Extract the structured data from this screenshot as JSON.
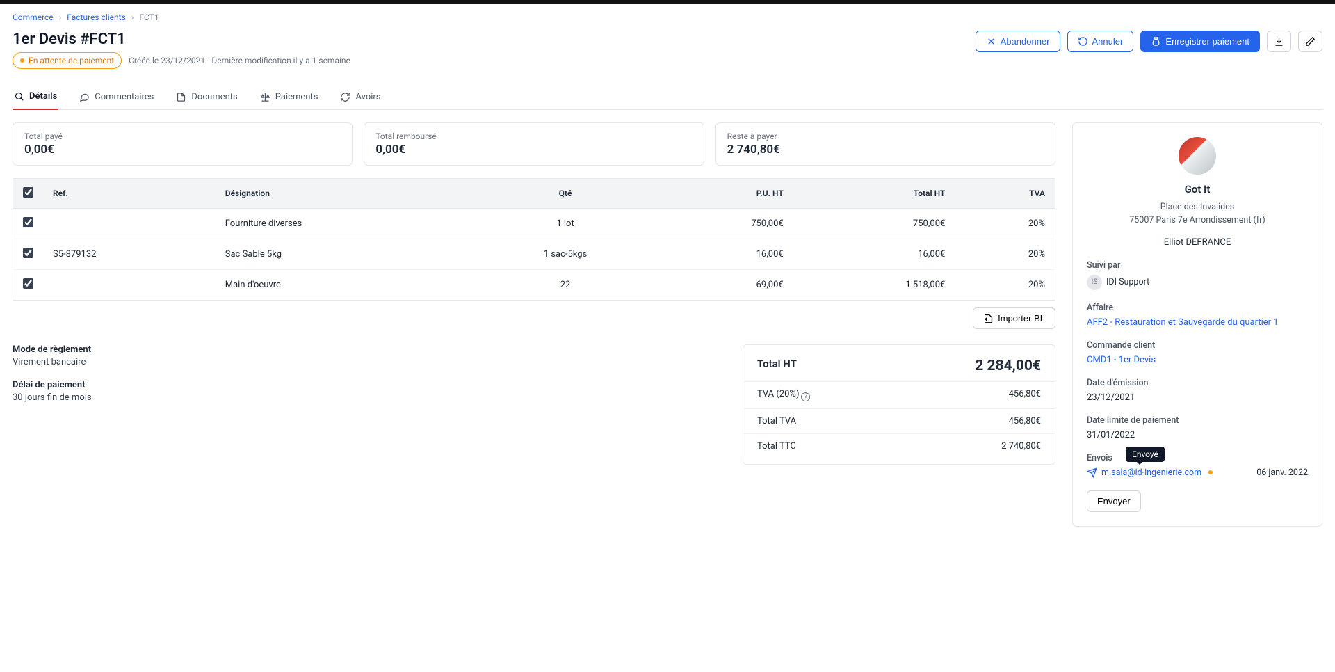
{
  "breadcrumb": {
    "l1": "Commerce",
    "l2": "Factures clients",
    "l3": "FCT1"
  },
  "header": {
    "title": "1er Devis #FCT1",
    "status": "En attente de paiement",
    "meta": "Créée le 23/12/2021 - Dernière modification il y a 1 semaine",
    "btn_abandon": "Abandonner",
    "btn_cancel": "Annuler",
    "btn_register": "Enregistrer paiement"
  },
  "tabs": {
    "details": "Détails",
    "comments": "Commentaires",
    "documents": "Documents",
    "payments": "Paiements",
    "credits": "Avoirs"
  },
  "summary": {
    "paid_label": "Total payé",
    "paid_value": "0,00€",
    "refunded_label": "Total remboursé",
    "refunded_value": "0,00€",
    "remaining_label": "Reste à payer",
    "remaining_value": "2 740,80€"
  },
  "table": {
    "col_ref": "Ref.",
    "col_desig": "Désignation",
    "col_qty": "Qté",
    "col_pu": "P.U. HT",
    "col_total": "Total HT",
    "col_tva": "TVA",
    "rows": [
      {
        "ref": "",
        "desig": "Fourniture diverses",
        "qty": "1 lot",
        "pu": "750,00€",
        "total": "750,00€",
        "tva": "20%"
      },
      {
        "ref": "S5-879132",
        "desig": "Sac Sable 5kg",
        "qty": "1 sac-5kgs",
        "pu": "16,00€",
        "total": "16,00€",
        "tva": "20%"
      },
      {
        "ref": "",
        "desig": "Main d'oeuvre",
        "qty": "22",
        "pu": "69,00€",
        "total": "1 518,00€",
        "tva": "20%"
      }
    ]
  },
  "import_bl": "Importer BL",
  "payment": {
    "mode_label": "Mode de règlement",
    "mode_value": "Virement bancaire",
    "delay_label": "Délai de paiement",
    "delay_value": "30 jours fin de mois"
  },
  "totals": {
    "ht_label": "Total HT",
    "ht_value": "2 284,00€",
    "tva20_label": "TVA (20%)",
    "tva20_value": "456,80€",
    "tva_total_label": "Total TVA",
    "tva_total_value": "456,80€",
    "ttc_label": "Total TTC",
    "ttc_value": "2 740,80€"
  },
  "customer": {
    "name": "Got It",
    "addr1": "Place des Invalides",
    "addr2": "75007 Paris 7e Arrondissement (fr)",
    "contact": "Elliot DEFRANCE"
  },
  "sidebar": {
    "followed_label": "Suivi par",
    "follower_initials": "IS",
    "follower_name": "IDI Support",
    "affaire_label": "Affaire",
    "affaire_link": "AFF2 - Restauration et Sauvegarde du quartier 1",
    "cmd_label": "Commande client",
    "cmd_link": "CMD1 - 1er Devis",
    "emission_label": "Date d'émission",
    "emission_value": "23/12/2021",
    "due_label": "Date limite de paiement",
    "due_value": "31/01/2022",
    "envois_label": "Envois",
    "envoi_email": "m.sala@id-ingenierie.com",
    "envoi_date": "06 janv. 2022",
    "envoi_tooltip": "Envoyé",
    "send_btn": "Envoyer"
  }
}
